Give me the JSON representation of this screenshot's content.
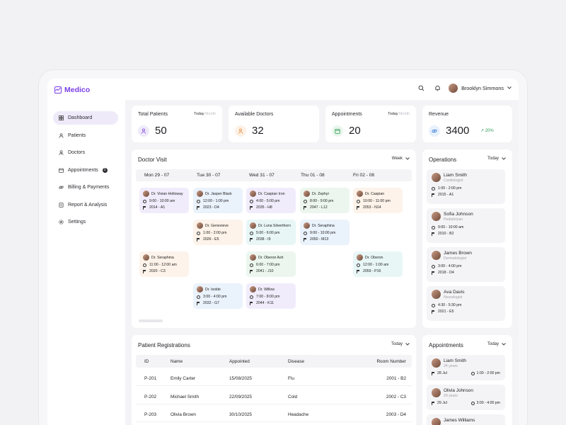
{
  "app": {
    "name": "Medico"
  },
  "header": {
    "user_name": "Brooklyn Simmons"
  },
  "sidebar": {
    "items": [
      {
        "label": "Dashboard",
        "icon": "grid-icon"
      },
      {
        "label": "Patients",
        "icon": "user-icon"
      },
      {
        "label": "Doctors",
        "icon": "doctor-icon"
      },
      {
        "label": "Appointments",
        "icon": "calendar-icon",
        "badge": "2"
      },
      {
        "label": "Billing & Payments",
        "icon": "link-icon"
      },
      {
        "label": "Report & Analysis",
        "icon": "report-icon"
      },
      {
        "label": "Settings",
        "icon": "gear-icon"
      }
    ]
  },
  "stats": {
    "total_patients": {
      "title": "Total Patients",
      "period_active": "Today",
      "period_muted": "Month",
      "value": "50"
    },
    "available_doctors": {
      "title": "Available Doctors",
      "value": "32"
    },
    "appointments": {
      "title": "Appointments",
      "period_active": "Today",
      "period_muted": "Month",
      "value": "20"
    },
    "revenue": {
      "title": "Revenue",
      "value": "3400",
      "change": "↗ 20%"
    }
  },
  "doctor_visit": {
    "title": "Doctor Visit",
    "filter": "Week",
    "days": [
      "Mon 29 - 07",
      "Tue 30 - 07",
      "Wed 31 - 07",
      "Thu 01 - 08",
      "Fri 02 - 08"
    ],
    "visits": [
      {
        "doctor": "Dr. Vivian Holloway",
        "time": "9:00 - 10:00 am",
        "room": "2014 - A1"
      },
      {
        "doctor": "Dr. Jasper Black",
        "time": "12:00 - 1:00 pm",
        "room": "2023 - D4"
      },
      {
        "doctor": "Dr. Caspian Iron",
        "time": "4:00 - 5:00 pm",
        "room": "2035 - H8"
      },
      {
        "doctor": "Dr. Zephyr",
        "time": "8:00 - 9:00 pm",
        "room": "2047 - L12"
      },
      {
        "doctor": "Dr. Caspian",
        "time": "10:00 - 11:00 pm",
        "room": "2053 - N14"
      },
      {
        "doctor": "Dr. Genevieve",
        "time": "1:00 - 2:00 pm",
        "room": "2026 - E5"
      },
      {
        "doctor": "Dr. Luna Silverthorn",
        "time": "5:00 - 6:00 pm",
        "room": "2038 - I9"
      },
      {
        "doctor": "Dr. Seraphina",
        "time": "9:00 - 10:00 pm",
        "room": "2050 - M13"
      },
      {
        "doctor": "Dr. Seraphina",
        "time": "11:00 - 12:00 am",
        "room": "2020 - C3"
      },
      {
        "doctor": "Dr. Oberon Ash",
        "time": "6:00 - 7:00 pm",
        "room": "2041 - J10"
      },
      {
        "doctor": "Dr. Oberon",
        "time": "12:00 - 1:00 am",
        "room": "2059 - P16"
      },
      {
        "doctor": "Dr. Isolde",
        "time": "3:00 - 4:00 pm",
        "room": "2032 - G7"
      },
      {
        "doctor": "Dr. Willow",
        "time": "7:00 - 8:00 pm",
        "room": "2044 - K11"
      }
    ]
  },
  "operations": {
    "title": "Operations",
    "filter": "Today",
    "items": [
      {
        "name": "Liam Smith",
        "role": "Cardiologist",
        "time": "1:00 - 2:00 pm",
        "room": "2015 - A1"
      },
      {
        "name": "Sofia Johnson",
        "role": "Pediatrician",
        "time": "9:00 - 10:00 am",
        "room": "2010 - B2"
      },
      {
        "name": "James Brown",
        "role": "Dermatologist",
        "time": "3:00 - 4:00 pm",
        "room": "2018 - D4"
      },
      {
        "name": "Ava Davis",
        "role": "Neurologist",
        "time": "4:30 - 5:30 pm",
        "room": "2021 - E5"
      }
    ]
  },
  "registrations": {
    "title": "Patient Registrations",
    "filter": "Today",
    "columns": [
      "ID",
      "Name",
      "Appointed",
      "Disease",
      "Room Number"
    ],
    "rows": [
      [
        "P-201",
        "Emily Carter",
        "15/08/2025",
        "Flu",
        "2001 - B2"
      ],
      [
        "P-202",
        "Michael Smith",
        "22/09/2025",
        "Cold",
        "2002 - C3"
      ],
      [
        "P-203",
        "Olivia Brown",
        "30/10/2025",
        "Headache",
        "2003 - D4"
      ]
    ]
  },
  "appointments_panel": {
    "title": "Appointments",
    "filter": "Today",
    "items": [
      {
        "name": "Liam Smith",
        "age": "24 years",
        "date": "28 Jul",
        "time": "1:00 - 2:00 pm"
      },
      {
        "name": "Olivia Johnson",
        "age": "29 years",
        "date": "29 Jul",
        "time": "3:00 - 4:00 pm"
      },
      {
        "name": "James Williams"
      }
    ]
  },
  "colors": {
    "accent": "#7b3fe4",
    "purple_soft": "#f1ecfb",
    "blue_soft": "#eaf2fb",
    "green_soft": "#ecf6ee",
    "orange_soft": "#fdf3ea",
    "positive": "#2e9d57"
  }
}
